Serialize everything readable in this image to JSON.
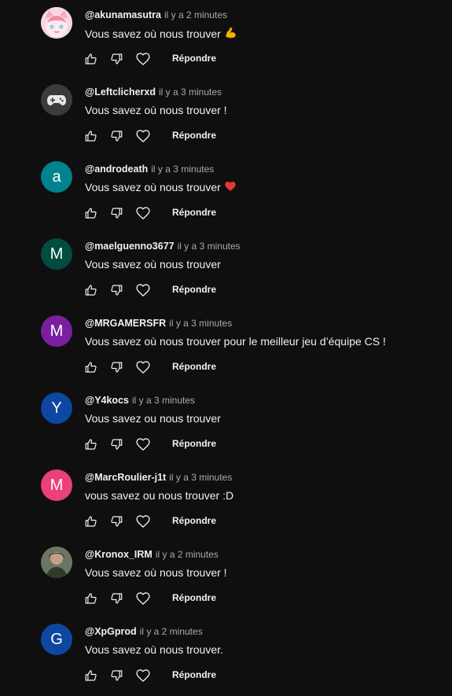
{
  "reply_label": "Répondre",
  "colors": {
    "background": "#0f0f0f",
    "text": "#f1f1f1",
    "secondary_text": "#aaaaaa"
  },
  "comments": [
    {
      "author": "@akunamasutra",
      "time": "il y a 2 minutes",
      "text": "Vous savez où nous trouver",
      "emoji": "flexed-biceps-emoji",
      "avatar": {
        "type": "image",
        "name": "pink-anime-cat-avatar",
        "color": "#f3c4cf"
      }
    },
    {
      "author": "@Leftclicherxd",
      "time": "il y a 3 minutes",
      "text": "Vous savez où nous trouver !",
      "avatar": {
        "type": "icon",
        "name": "gamepad-icon",
        "color": "#3b3b3b"
      }
    },
    {
      "author": "@androdeath",
      "time": "il y a 3 minutes",
      "text": "Vous savez où nous trouver",
      "emoji": "red-heart-emoji",
      "avatar": {
        "type": "letter",
        "letter": "a",
        "color": "#00838f"
      }
    },
    {
      "author": "@maelguenno3677",
      "time": "il y a 3 minutes",
      "text": "Vous savez où nous trouver",
      "avatar": {
        "type": "letter",
        "letter": "M",
        "color": "#004d40"
      }
    },
    {
      "author": "@MRGAMERSFR",
      "time": "il y a 3 minutes",
      "text": "Vous savez où nous trouver pour le meilleur jeu d’équipe CS !",
      "avatar": {
        "type": "letter",
        "letter": "M",
        "color": "#7b1fa2"
      }
    },
    {
      "author": "@Y4kocs",
      "time": "il y a 3 minutes",
      "text": "Vous savez ou nous trouver",
      "avatar": {
        "type": "letter",
        "letter": "Y",
        "color": "#0d47a1"
      }
    },
    {
      "author": "@MarcRoulier-j1t",
      "time": "il y a 3 minutes",
      "text": "vous savez ou nous trouver :D",
      "avatar": {
        "type": "letter",
        "letter": "M",
        "color": "#ec407a"
      }
    },
    {
      "author": "@Kronox_IRM",
      "time": "il y a 2 minutes",
      "text": "Vous savez où nous trouver !",
      "avatar": {
        "type": "image",
        "name": "portrait-photo-avatar",
        "color": "#4e5b4a"
      }
    },
    {
      "author": "@XpGprod",
      "time": "il y a 2 minutes",
      "text": "Vous savez où nous trouver.",
      "avatar": {
        "type": "letter",
        "letter": "G",
        "color": "#0d47a1"
      }
    }
  ]
}
